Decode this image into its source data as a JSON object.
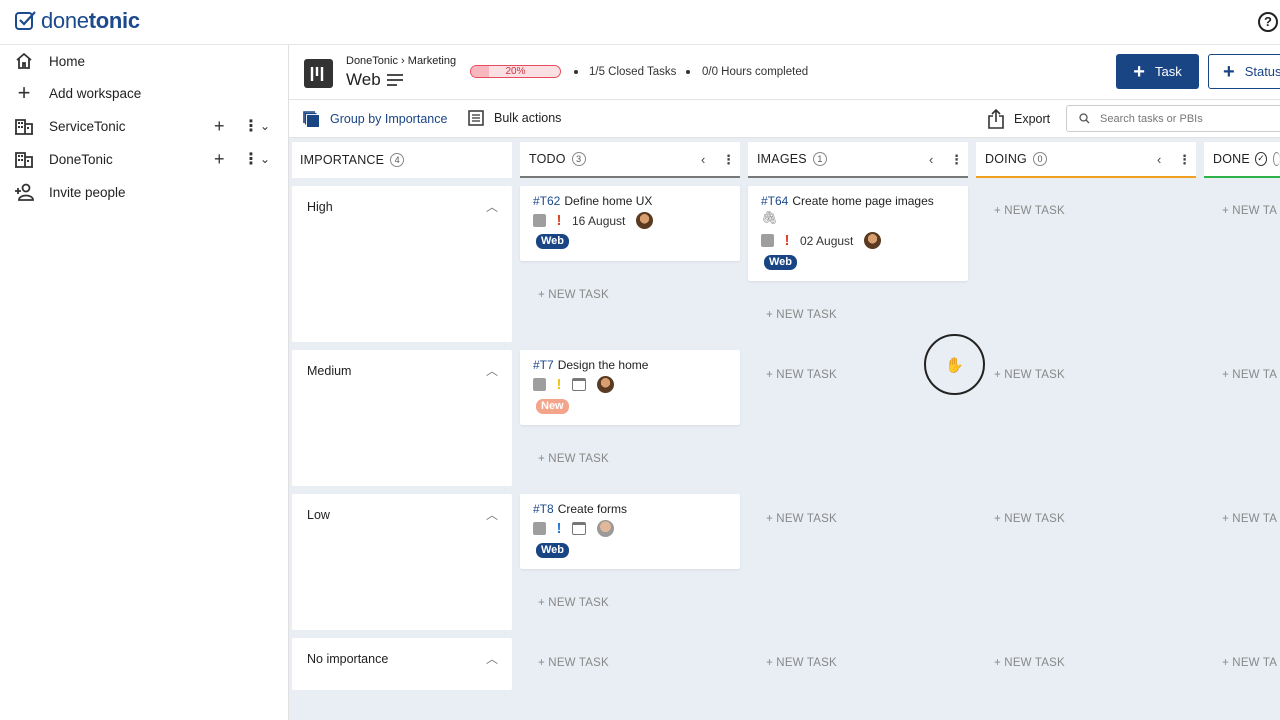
{
  "app": {
    "logo_part1": "done",
    "logo_part2": "tonic",
    "help_icon": "?"
  },
  "sidebar": {
    "items": [
      {
        "label": "Home",
        "icon": "home-icon"
      },
      {
        "label": "Add workspace",
        "icon": "plus-icon"
      },
      {
        "label": "ServiceTonic",
        "icon": "building-icon"
      },
      {
        "label": "DoneTonic",
        "icon": "building-icon"
      },
      {
        "label": "Invite people",
        "icon": "add-person-icon"
      }
    ]
  },
  "header": {
    "breadcrumb_parent": "DoneTonic",
    "breadcrumb_child": "Marketing",
    "title": "Web",
    "progress_text": "20%",
    "progress_value": 0.2,
    "closed_tasks": "1/5 Closed Tasks",
    "hours": "0/0 Hours completed",
    "task_button": "Task",
    "status_button": "Status"
  },
  "toolbar": {
    "group_by": "Group by Importance",
    "bulk": "Bulk actions",
    "export": "Export",
    "search_placeholder": "Search tasks or PBIs"
  },
  "columns": {
    "importance": {
      "name": "IMPORTANCE",
      "count": "4"
    },
    "todo": {
      "name": "TODO",
      "count": "3"
    },
    "images": {
      "name": "IMAGES",
      "count": "1"
    },
    "doing": {
      "name": "DOING",
      "count": "0"
    },
    "done": {
      "name": "DONE"
    }
  },
  "importance_levels": [
    "High",
    "Medium",
    "Low",
    "No importance"
  ],
  "new_task_label": "+ NEW TASK",
  "new_task_truncated": "+ NEW TA",
  "cards": {
    "t62": {
      "id": "#T62",
      "title": "Define home UX",
      "date": "16 August",
      "tag": "Web",
      "priority_color": "#d9442b"
    },
    "t64": {
      "id": "#T64",
      "title": "Create home page images",
      "date": "02 August",
      "tag": "Web",
      "priority_color": "#d9442b"
    },
    "t7": {
      "id": "#T7",
      "title": "Design the home",
      "tag": "New",
      "priority_color": "#f2c318"
    },
    "t8": {
      "id": "#T8",
      "title": "Create forms",
      "tag": "Web",
      "priority_color": "#2a7ad8"
    }
  },
  "colors": {
    "brand": "#1a4585",
    "tag_web": "#1a4585",
    "tag_new": "#f4a48a",
    "doing_line": "#f0a020",
    "done_line": "#2db34a"
  }
}
